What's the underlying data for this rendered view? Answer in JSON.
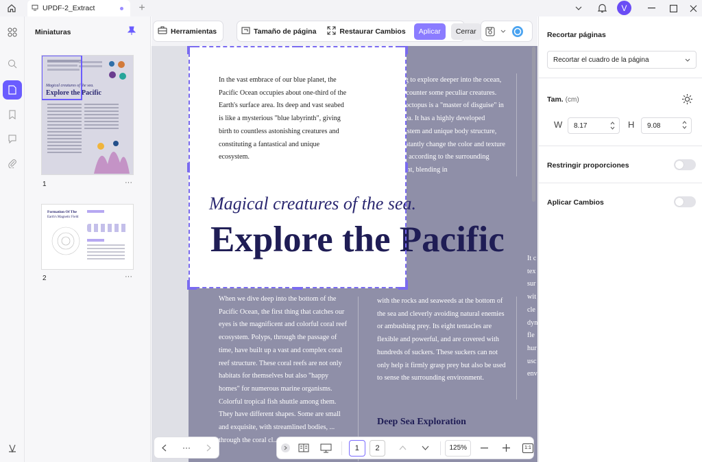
{
  "window": {
    "tab_title": "UPDF-2_Extract",
    "avatar_letter": "V",
    "accent": "#6a5cff"
  },
  "thumbnails": {
    "title": "Miniaturas",
    "pages": [
      {
        "number": "1",
        "more": "···",
        "subtitle": "Magical creatures of the sea.",
        "title": "Explore the Pacific"
      },
      {
        "number": "2",
        "more": "···",
        "subtitle": "Formation Of The",
        "title": "Earth's Magnetic Field"
      }
    ]
  },
  "toolbar": {
    "tools_label": "Herramientas",
    "page_size_label": "Tamaño de página",
    "restore_label": "Restaurar Cambios",
    "apply_label": "Aplicar",
    "close_label": "Cerrar"
  },
  "document": {
    "col1_top": "In the vast embrace of our blue planet, the Pacific Ocean occupies about one-third of the Earth's surface area. Its deep and vast seabed is like a mysterious \"blue labyrinth\", giving birth to countless astonishing creatures and constituting a fantastical and unique ecosystem.",
    "col2_top": "Continuing to explore deeper into the ocean, we will encounter some peculiar creatures. The giant octopus is a \"master of disguise\" in the deep sea. It has a highly developed nervous system and unique body structure, and can instantly change the color and texture of its body according to the surrounding environment, blending in",
    "subtitle": "Magical creatures of the sea.",
    "title": "Explore the Pacific",
    "col1_bottom": "When we dive deep into the bottom of the Pacific Ocean, the first thing that catches our eyes is the magnificent and colorful coral reef ecosystem. Polyps, through the passage of time, have built up a vast and complex coral reef structure. These coral reefs are not only habitats for themselves but also \"happy homes\" for numerous marine organisms. Colorful tropical fish shuttle among them. They have different shapes. Some are small and exquisite, with streamlined bodies, ... through the coral cl...",
    "col2_bottom": "with the rocks and seaweeds at the bottom of the sea and cleverly avoiding natural enemies or ambushing prey. Its eight tentacles are flexible and powerful, and are covered with hundreds of suckers. These suckers can not only help it firmly grasp prey but also be used to sense the surrounding environment.",
    "section_heading": "Deep Sea Exploration",
    "col3_fragments": [
      "It c",
      "tex",
      "sur",
      "wit",
      "cle",
      "dyn",
      "fle",
      "hur",
      "usc",
      "env"
    ]
  },
  "bottom": {
    "nav_more": "···",
    "pages": [
      "1",
      "2"
    ],
    "zoom": "125%",
    "fit_label": "1:1"
  },
  "right_panel": {
    "title": "Recortar páginas",
    "mode_select": "Recortar el cuadro de la página",
    "size_label": "Tam.",
    "size_unit": "(cm)",
    "w_label": "W",
    "w_value": "8.17",
    "h_label": "H",
    "h_value": "9.08",
    "constrain_label": "Restringir proporciones",
    "apply_changes_label": "Aplicar Cambios",
    "constrain_on": false,
    "apply_changes_on": false
  }
}
